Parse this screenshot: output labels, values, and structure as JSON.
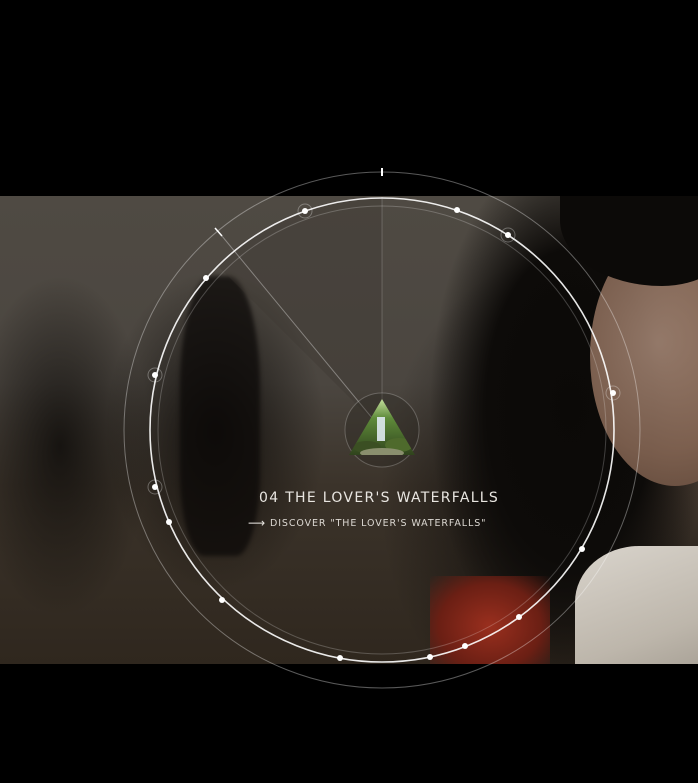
{
  "location": {
    "number": "04",
    "title": "THE LOVER'S WATERFALLS",
    "discover_label": "DISCOVER \"THE LOVER'S WATERFALLS\""
  },
  "icons": {
    "thumbnail": "waterfall-triangle-thumbnail",
    "arrow": "arrow-right-icon"
  },
  "colors": {
    "background": "#000000",
    "ring": "#ffffff",
    "text": "#e9e6e1"
  }
}
